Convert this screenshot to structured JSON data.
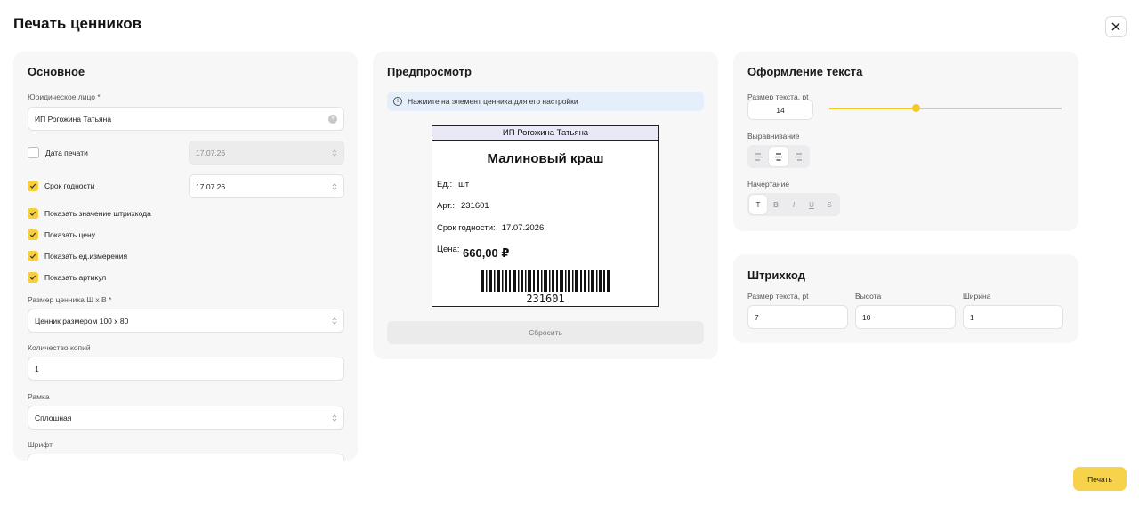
{
  "dialog": {
    "title": "Печать ценников"
  },
  "main": {
    "title": "Основное",
    "legal_entity": {
      "label": "Юридическое лицо *",
      "value": "ИП Рогожина Татьяна"
    },
    "print_date": {
      "label": "Дата печати",
      "value": "17.07.26",
      "checked": false
    },
    "expiry": {
      "label": "Срок годности",
      "value": "17.07.26",
      "checked": true
    },
    "options": [
      {
        "label": "Показать значение штрихкода",
        "checked": true
      },
      {
        "label": "Показать цену",
        "checked": true
      },
      {
        "label": "Показать ед.измерения",
        "checked": true
      },
      {
        "label": "Показать артикул",
        "checked": true
      }
    ],
    "size": {
      "label": "Размер ценника Ш х В *",
      "value": "Ценник размером 100 x 80"
    },
    "copies": {
      "label": "Количество копий",
      "value": "1"
    },
    "frame": {
      "label": "Рамка",
      "value": "Сплошная"
    },
    "font": {
      "label": "Шрифт"
    }
  },
  "preview": {
    "title": "Предпросмотр",
    "info": "Нажмите на элемент ценника для его настройки",
    "tag": {
      "header": "ИП Рогожина Татьяна",
      "name": "Малиновый краш",
      "unit_label": "Ед.:",
      "unit_value": "шт",
      "sku_label": "Арт.:",
      "sku_value": "231601",
      "expiry_label": "Срок годности:",
      "expiry_value": "17.07.2026",
      "price_label": "Цена:",
      "price_value": "660,00 ₽",
      "barcode_value": "231601"
    },
    "reset_label": "Сбросить"
  },
  "text_style": {
    "title": "Оформление текста",
    "size_label": "Размер текста, pt",
    "size_value": "14",
    "size_slider_fraction": 0.37,
    "align_label": "Выравнивание",
    "align_icons": [
      "align-left-icon",
      "align-center-icon",
      "align-right-icon"
    ],
    "align_active": 1,
    "style_label": "Начертание",
    "style_items": [
      "T",
      "B",
      "I",
      "U",
      "S"
    ],
    "style_active": 0
  },
  "barcode": {
    "title": "Штрихкод",
    "text_size_label": "Размер текста, pt",
    "text_size_value": "7",
    "height_label": "Высота",
    "height_value": "10",
    "width_label": "Ширина",
    "width_value": "1"
  },
  "footer": {
    "print_label": "Печать"
  },
  "colors": {
    "accent": "#f6d34a",
    "card": "#f7f7f8",
    "info": "#e5eefb"
  }
}
